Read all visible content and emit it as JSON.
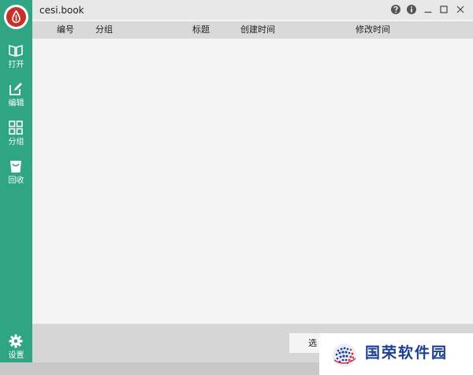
{
  "window": {
    "title": "cesi.book"
  },
  "sidebar": {
    "items": [
      {
        "label": "打开",
        "icon": "open-book-icon"
      },
      {
        "label": "编辑",
        "icon": "edit-icon"
      },
      {
        "label": "分组",
        "icon": "grid-icon"
      },
      {
        "label": "回收",
        "icon": "recycle-bin-icon"
      }
    ],
    "settings": {
      "label": "设置",
      "icon": "gear-icon"
    }
  },
  "table": {
    "columns": [
      "编号",
      "分组",
      "标题",
      "创建时间",
      "修改时间"
    ]
  },
  "footer": {
    "button_label": "选"
  },
  "watermark": {
    "text": "国荣软件园"
  },
  "colors": {
    "sidebar": "#2fa583",
    "logo": "#c8312a"
  }
}
